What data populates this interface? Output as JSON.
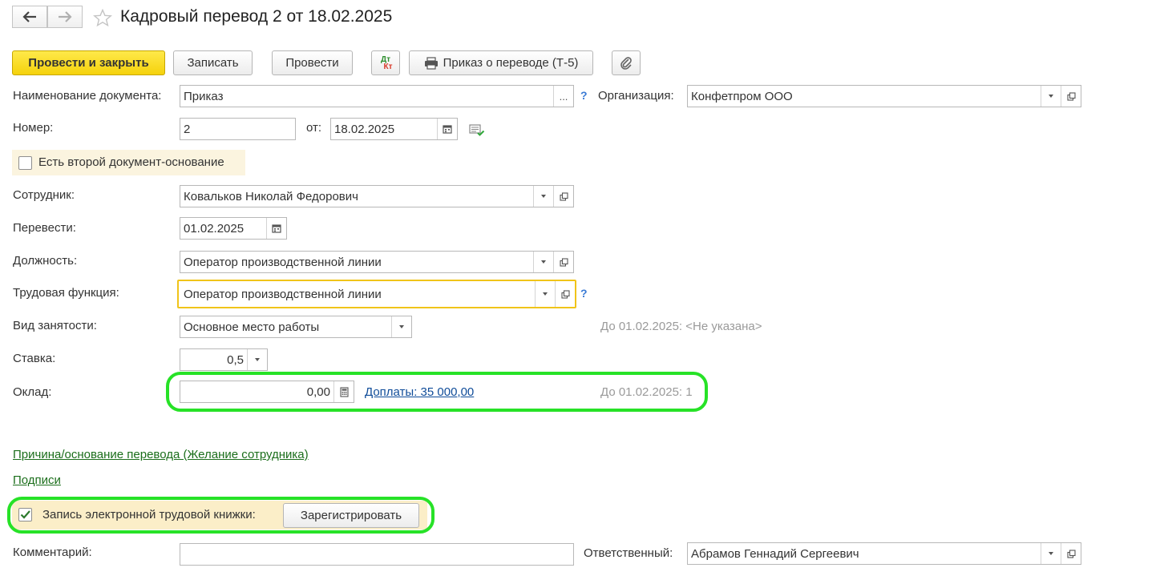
{
  "window": {
    "title": "Кадровый перевод 2 от 18.02.2025"
  },
  "toolbar": {
    "post_close": "Провести и закрыть",
    "save": "Записать",
    "post": "Провести",
    "dtkt_top": "Дт",
    "dtkt_bottom": "Кт",
    "print_order": "Приказ о переводе (Т-5)"
  },
  "form": {
    "doc_name_label": "Наименование документа:",
    "doc_name_value": "Приказ",
    "doc_name_select": "...",
    "help": "?",
    "org_label": "Организация:",
    "org_value": "Конфетпром ООО",
    "number_label": "Номер:",
    "number_value": "2",
    "date_label": "от:",
    "date_value": "18.02.2025",
    "second_basis_label": "Есть второй документ-основание",
    "employee_label": "Сотрудник:",
    "employee_value": "Ковальков Николай Федорович",
    "transfer_label": "Перевести:",
    "transfer_value": "01.02.2025",
    "position_label": "Должность:",
    "position_value": "Оператор производственной линии",
    "function_label": "Трудовая функция:",
    "function_value": "Оператор производственной линии",
    "employment_label": "Вид занятости:",
    "employment_value": "Основное место работы",
    "employment_hint": "До 01.02.2025: <Не указана>",
    "rate_label": "Ставка:",
    "rate_value": "0,5",
    "salary_label": "Оклад:",
    "salary_value": "0,00",
    "allowances_link": "Доплаты: 35 000,00",
    "salary_hint": "До 01.02.2025: 1",
    "reason_link": "Причина/основание перевода (Желание сотрудника)",
    "signatures_link": "Подписи",
    "etk_label": "Запись электронной трудовой книжки:",
    "etk_button": "Зарегистрировать",
    "comment_label": "Комментарий:",
    "comment_value": "",
    "responsible_label": "Ответственный:",
    "responsible_value": "Абрамов Геннадий Сергеевич"
  },
  "colors": {
    "primary_button": "#f5d20c",
    "highlight_ring": "#27e227",
    "function_border": "#f0c419",
    "second_basis_bg": "#fbf4df",
    "etk_bg": "#fbeec8",
    "link": "#1b6e1b"
  }
}
